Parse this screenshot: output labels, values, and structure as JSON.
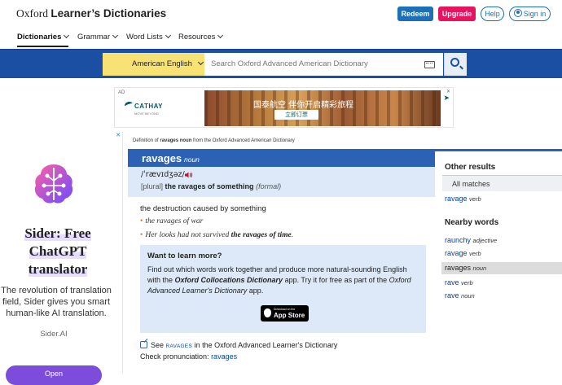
{
  "header": {
    "logo_prefix": "Oxford ",
    "logo_main": "Learner’s Dictionaries",
    "redeem": "Redeem",
    "upgrade": "Upgrade",
    "help": "Help",
    "signin": "Sign in"
  },
  "nav": {
    "items": [
      "Dictionaries",
      "Grammar",
      "Word Lists",
      "Resources"
    ]
  },
  "search": {
    "dictionary": "American English",
    "placeholder": "Search Oxford Advanced American Dictionary"
  },
  "top_ad": {
    "label": "AD",
    "brand": "CATHAY",
    "brand_sub": "MOVE BEYOND",
    "headline": "国泰航空 伴你开启精彩旅程",
    "cta": "立即订票"
  },
  "side_ad": {
    "title_line1": "Sider: Free",
    "title_line2": "ChatGPT",
    "title_line3": "translator",
    "body": "The revolution of translation field, Sider gives you smart human-like AI translation.",
    "brand": "Sider.AI",
    "button": "Open"
  },
  "entry": {
    "source_prefix": "Definition of ",
    "source_word": "ravages noun",
    "source_suffix": " from the Oxford Advanced American Dictionary",
    "headword": "ravages",
    "pos": "noun",
    "phonetic": "/ˈrævɪdʒəz/",
    "grammar": "[plural]",
    "phrase": "the ravages of something",
    "register": "(formal)",
    "definition": "the destruction caused by something",
    "examples": [
      {
        "text": "the ravages of war",
        "bold": ""
      },
      {
        "text": "Her looks had not survived ",
        "bold": "the ravages of time",
        "tail": "."
      }
    ],
    "learn_title": "Want to learn more?",
    "learn_text_1": "Find out which words work together and produce more natural-sounding English with the ",
    "learn_text_2": "Oxford Collocations Dictionary",
    "learn_text_3": " app. Try it for free as part of the ",
    "learn_text_4": "Oxford Advanced Learner's Dictionary",
    "learn_text_5": " app.",
    "appstore_small": "Download on the",
    "appstore_big": "App Store",
    "see_prefix": "See ",
    "see_word": "RAVAGES",
    "see_suffix": " in the Oxford Advanced Learner's Dictionary",
    "pron_prefix": "Check pronunciation: ",
    "pron_word": "ravages"
  },
  "sidebar": {
    "other_results_title": "Other results",
    "all_matches": "All matches",
    "other_results": [
      {
        "word": "ravage",
        "pos": "verb"
      }
    ],
    "nearby_title": "Nearby words",
    "nearby": [
      {
        "word": "raunchy",
        "pos": "adjective"
      },
      {
        "word": "ravage",
        "pos": "verb"
      },
      {
        "word": "ravages",
        "pos": "noun"
      },
      {
        "word": "rave",
        "pos": "verb"
      },
      {
        "word": "rave",
        "pos": "noun"
      }
    ]
  },
  "colors": {
    "brand_blue": "#1a4fa3",
    "entry_blue": "#2b62b5",
    "upgrade_pink": "#e8135f",
    "dictionary_yellow": "#f7e273"
  }
}
